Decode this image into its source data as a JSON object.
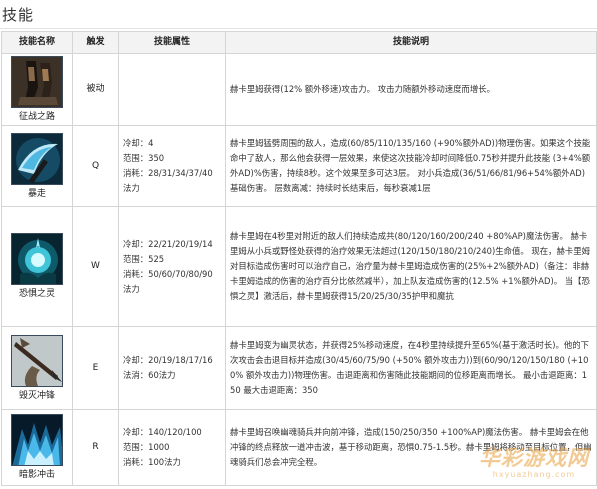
{
  "section_title": "技能",
  "columns": {
    "name": "技能名称",
    "trigger": "触发",
    "attributes": "技能属性",
    "description": "技能说明"
  },
  "skills": [
    {
      "name": "征战之路",
      "icon": "legs-walking-icon",
      "trigger": "被动",
      "attributes": [
        "",
        "",
        ""
      ],
      "description": "赫卡里姆获得(12% 额外移速)攻击力。 攻击力随额外移动速度而增长。"
    },
    {
      "name": "暴走",
      "icon": "axe-slash-icon",
      "trigger": "Q",
      "attributes": [
        "冷却：4",
        "范围：350",
        "消耗：28/31/34/37/40法力"
      ],
      "description": "赫卡里姆猛劈周围的敌人，造成(60/85/110/135/160 (+90%额外AD))物理伤害。如果这个技能命中了敌人，那么他会获得一层效果，来使这次技能冷却时间降低0.75秒并提升此技能 (3+4%额外AD)%伤害，持续8秒。这个效果至多可达3层。 对小兵造成(36/51/66/81/96+54%额外AD)基础伤害。 层数离减：持续时长结束后，每秒衰减1层"
    },
    {
      "name": "恐惧之灵",
      "icon": "spirit-orb-icon",
      "trigger": "W",
      "attributes": [
        "冷却：22/21/20/19/14",
        "范围：525",
        "消耗：50/60/70/80/90法力"
      ],
      "description": "赫卡里姆在4秒里对附近的敌人们持续造成共(80/120/160/200/240 +80%AP)魔法伤害。 赫卡里姆从小兵或野怪处获得的治疗效果无法超过(120/150/180/210/240)生命值。 现在，赫卡里姆对目标造成伤害时可以治疗自己，治疗量为赫卡里姆造成伤害的(25%+2%额外AD)（备注：非赫卡里姆造成的伤害的治疗百分比依然减半），加上队友造成伤害的(12.5% +1%额外AD)。 当【恐惧之灵】激活后，赫卡里姆获得15/20/25/30/35护甲和魔抗"
    },
    {
      "name": "毁灭冲锋",
      "icon": "spear-charge-icon",
      "trigger": "E",
      "attributes": [
        "冷却：20/19/18/17/16",
        "法消：60法力",
        ""
      ],
      "description": "赫卡里姆变为幽灵状态，并获得25%移动速度，在4秒里持续提升至65%(基于激活时长)。他的下次攻击会击退目标并造成(30/45/60/75/90 (+50% 额外攻击力))到(60/90/120/150/180 (+100% 额外攻击力))物理伤害。击退距离和伤害随此技能期间的位移距离而增长。 最小击退距离：150 最大击退距离：350"
    },
    {
      "name": "暗影冲击",
      "icon": "shadow-riders-icon",
      "trigger": "R",
      "attributes": [
        "冷却：140/120/100",
        "范围：1000",
        "消耗：100法力"
      ],
      "description": "赫卡里姆召唤幽魂骑兵并向前冲锋，造成(150/250/350 +100%AP)魔法伤害。 赫卡里姆会在他冲锋的终点释放一道冲击波，基于移动距离，恐惧0.75-1.5秒。赫卡里姆将移动至目标位置，但幽魂骑兵们总会冲完全程。"
    }
  ],
  "watermark": {
    "main": "华彩游戏网",
    "sub": "hxyuazhang.com"
  },
  "colors": {
    "header_bg": "#f3f3f3",
    "border": "#d5d5d5",
    "watermark": "#e9a03c"
  }
}
